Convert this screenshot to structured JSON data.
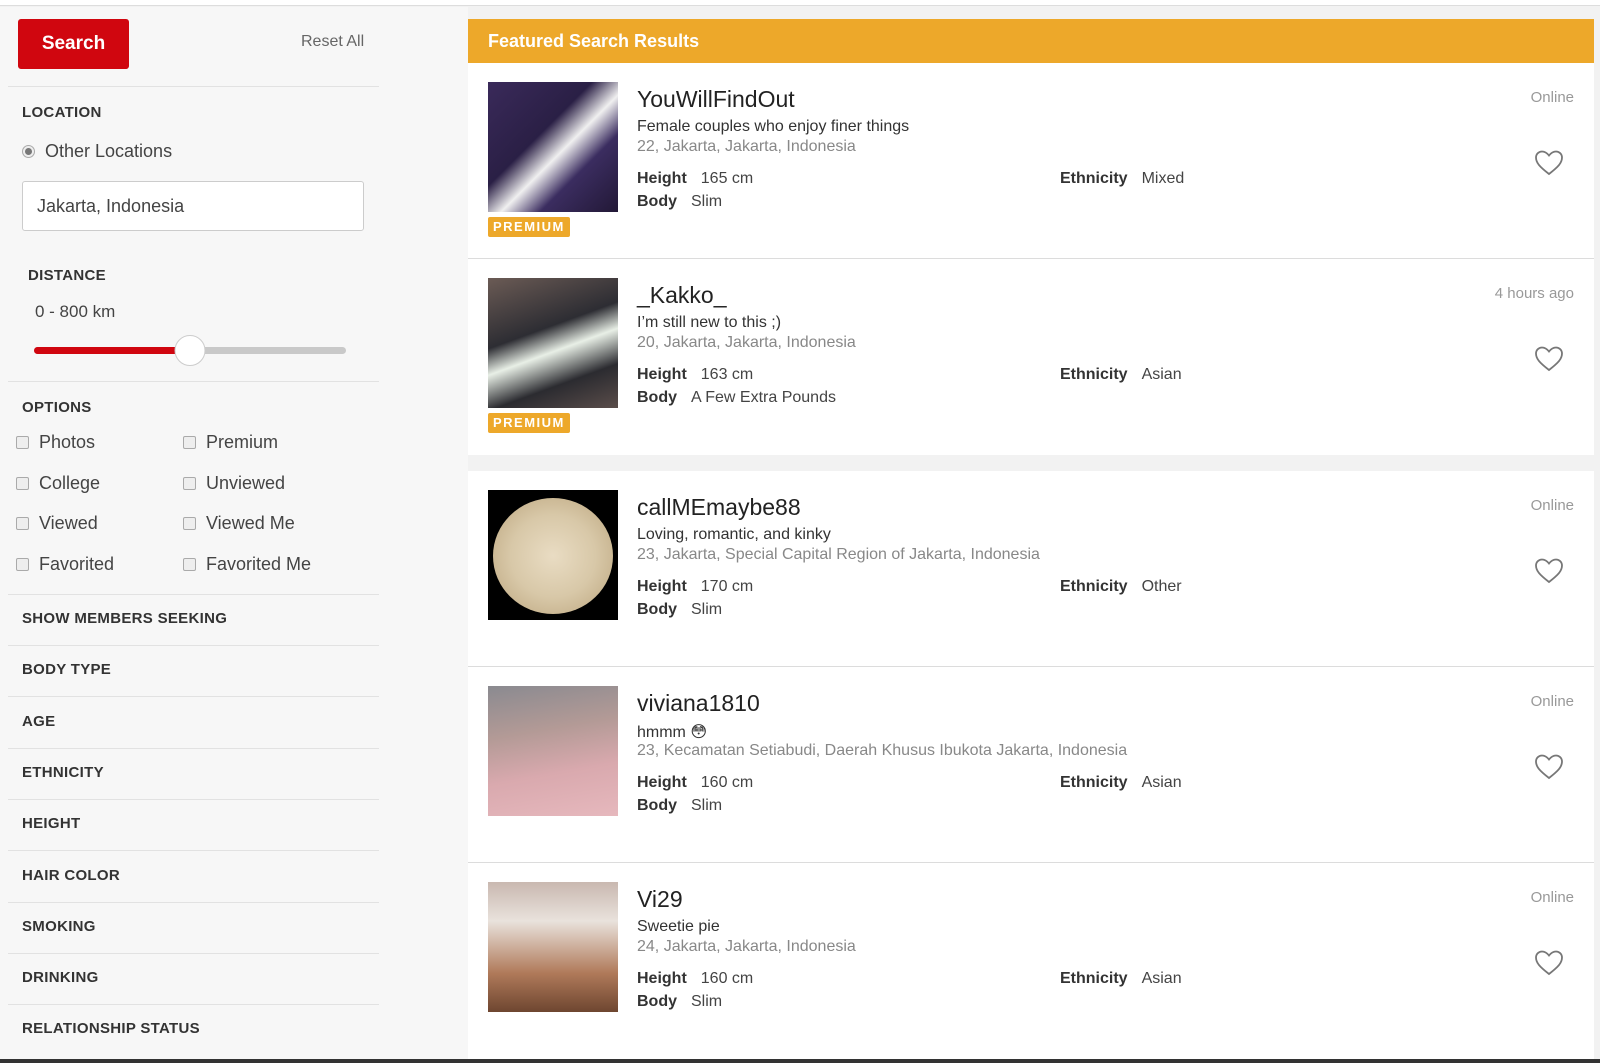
{
  "sidebar": {
    "search_button": "Search",
    "reset_link": "Reset All",
    "location": {
      "title": "LOCATION",
      "radio_label": "Other Locations",
      "radio_selected": true,
      "input_value": "Jakarta, Indonesia"
    },
    "distance": {
      "title": "DISTANCE",
      "value_text": "0 - 800 km",
      "slider_fraction": 0.5
    },
    "options": {
      "title": "OPTIONS",
      "items": [
        {
          "label": "Photos",
          "checked": false
        },
        {
          "label": "Premium",
          "checked": false
        },
        {
          "label": "College",
          "checked": false
        },
        {
          "label": "Unviewed",
          "checked": false
        },
        {
          "label": "Viewed",
          "checked": false
        },
        {
          "label": "Viewed Me",
          "checked": false
        },
        {
          "label": "Favorited",
          "checked": false
        },
        {
          "label": "Favorited Me",
          "checked": false
        }
      ]
    },
    "filters": [
      "SHOW MEMBERS SEEKING",
      "BODY TYPE",
      "AGE",
      "ETHNICITY",
      "HEIGHT",
      "HAIR COLOR",
      "SMOKING",
      "DRINKING",
      "RELATIONSHIP STATUS"
    ]
  },
  "main": {
    "featured_title": "Featured Search Results",
    "labels": {
      "height": "Height",
      "body": "Body",
      "ethnicity": "Ethnicity"
    },
    "premium_label": "PREMIUM",
    "colors": {
      "accent_red": "#d0060f",
      "featured_orange": "#eda82a"
    },
    "featured": [
      {
        "username": "YouWillFindOut",
        "tagline": "Female couples who enjoy finer things",
        "location": "22, Jakarta, Jakarta, Indonesia",
        "height": "165 cm",
        "body": "Slim",
        "ethnicity": "Mixed",
        "status": "Online",
        "premium": true,
        "photo_shape": "square"
      },
      {
        "username": "_Kakko_",
        "tagline": "I’m still new to this ;)",
        "location": "20, Jakarta, Jakarta, Indonesia",
        "height": "163 cm",
        "body": "A Few Extra Pounds",
        "ethnicity": "Asian",
        "status": "4 hours ago",
        "premium": true,
        "photo_shape": "square"
      }
    ],
    "results": [
      {
        "username": "callMEmaybe88",
        "tagline": "Loving, romantic, and kinky",
        "location": "23, Jakarta, Special Capital Region of Jakarta, Indonesia",
        "height": "170 cm",
        "body": "Slim",
        "ethnicity": "Other",
        "status": "Online",
        "premium": false,
        "photo_shape": "circle"
      },
      {
        "username": "viviana1810",
        "tagline": "hmmm 😳",
        "location": "23, Kecamatan Setiabudi, Daerah Khusus Ibukota Jakarta, Indonesia",
        "height": "160 cm",
        "body": "Slim",
        "ethnicity": "Asian",
        "status": "Online",
        "premium": false,
        "photo_shape": "square"
      },
      {
        "username": "Vi29",
        "tagline": "Sweetie pie",
        "location": "24, Jakarta, Jakarta, Indonesia",
        "height": "160 cm",
        "body": "Slim",
        "ethnicity": "Asian",
        "status": "Online",
        "premium": false,
        "photo_shape": "square"
      }
    ]
  }
}
